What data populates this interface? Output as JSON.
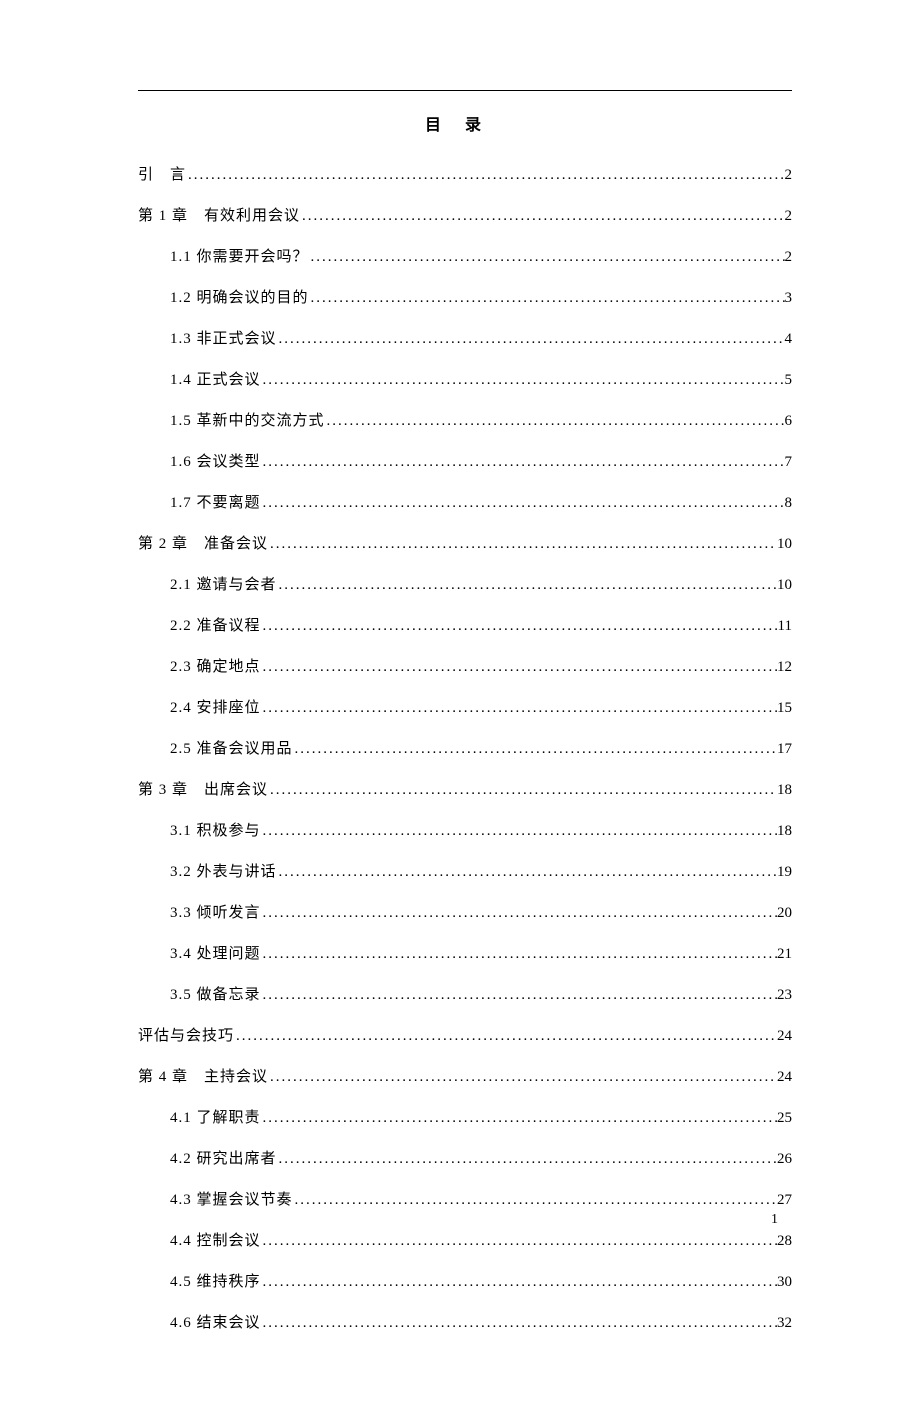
{
  "title": "目录",
  "page_number": "1",
  "entries": [
    {
      "level": 0,
      "label": "引　言",
      "page": "2"
    },
    {
      "level": 0,
      "label": "第 1 章　有效利用会议",
      "page": "2"
    },
    {
      "level": 1,
      "label": "1.1 你需要开会吗？",
      "page": "2"
    },
    {
      "level": 1,
      "label": "1.2 明确会议的目的",
      "page": "3"
    },
    {
      "level": 1,
      "label": "1.3 非正式会议",
      "page": "4"
    },
    {
      "level": 1,
      "label": "1.4 正式会议",
      "page": "5"
    },
    {
      "level": 1,
      "label": "1.5 革新中的交流方式",
      "page": "6"
    },
    {
      "level": 1,
      "label": "1.6 会议类型",
      "page": "7"
    },
    {
      "level": 1,
      "label": "1.7 不要离题",
      "page": "8"
    },
    {
      "level": 0,
      "label": "第 2 章　准备会议",
      "page": "10"
    },
    {
      "level": 1,
      "label": "2.1 邀请与会者",
      "page": "10"
    },
    {
      "level": 1,
      "label": "2.2 准备议程",
      "page": "11"
    },
    {
      "level": 1,
      "label": "2.3 确定地点",
      "page": "12"
    },
    {
      "level": 1,
      "label": "2.4 安排座位",
      "page": "15"
    },
    {
      "level": 1,
      "label": "2.5 准备会议用品",
      "page": "17"
    },
    {
      "level": 0,
      "label": "第 3 章　出席会议",
      "page": "18"
    },
    {
      "level": 1,
      "label": "3.1 积极参与",
      "page": "18"
    },
    {
      "level": 1,
      "label": "3.2 外表与讲话",
      "page": "19"
    },
    {
      "level": 1,
      "label": "3.3 倾听发言",
      "page": "20"
    },
    {
      "level": 1,
      "label": "3.4 处理问题",
      "page": "21"
    },
    {
      "level": 1,
      "label": "3.5 做备忘录",
      "page": "23"
    },
    {
      "level": 0,
      "label": "评估与会技巧",
      "page": "24"
    },
    {
      "level": 0,
      "label": "第 4 章　主持会议",
      "page": "24"
    },
    {
      "level": 1,
      "label": "4.1 了解职责",
      "page": "25"
    },
    {
      "level": 1,
      "label": "4.2 研究出席者",
      "page": "26"
    },
    {
      "level": 1,
      "label": "4.3 掌握会议节奏",
      "page": "27"
    },
    {
      "level": 1,
      "label": "4.4 控制会议",
      "page": "28"
    },
    {
      "level": 1,
      "label": "4.5 维持秩序",
      "page": "30"
    },
    {
      "level": 1,
      "label": "4.6 结束会议",
      "page": "32"
    }
  ]
}
